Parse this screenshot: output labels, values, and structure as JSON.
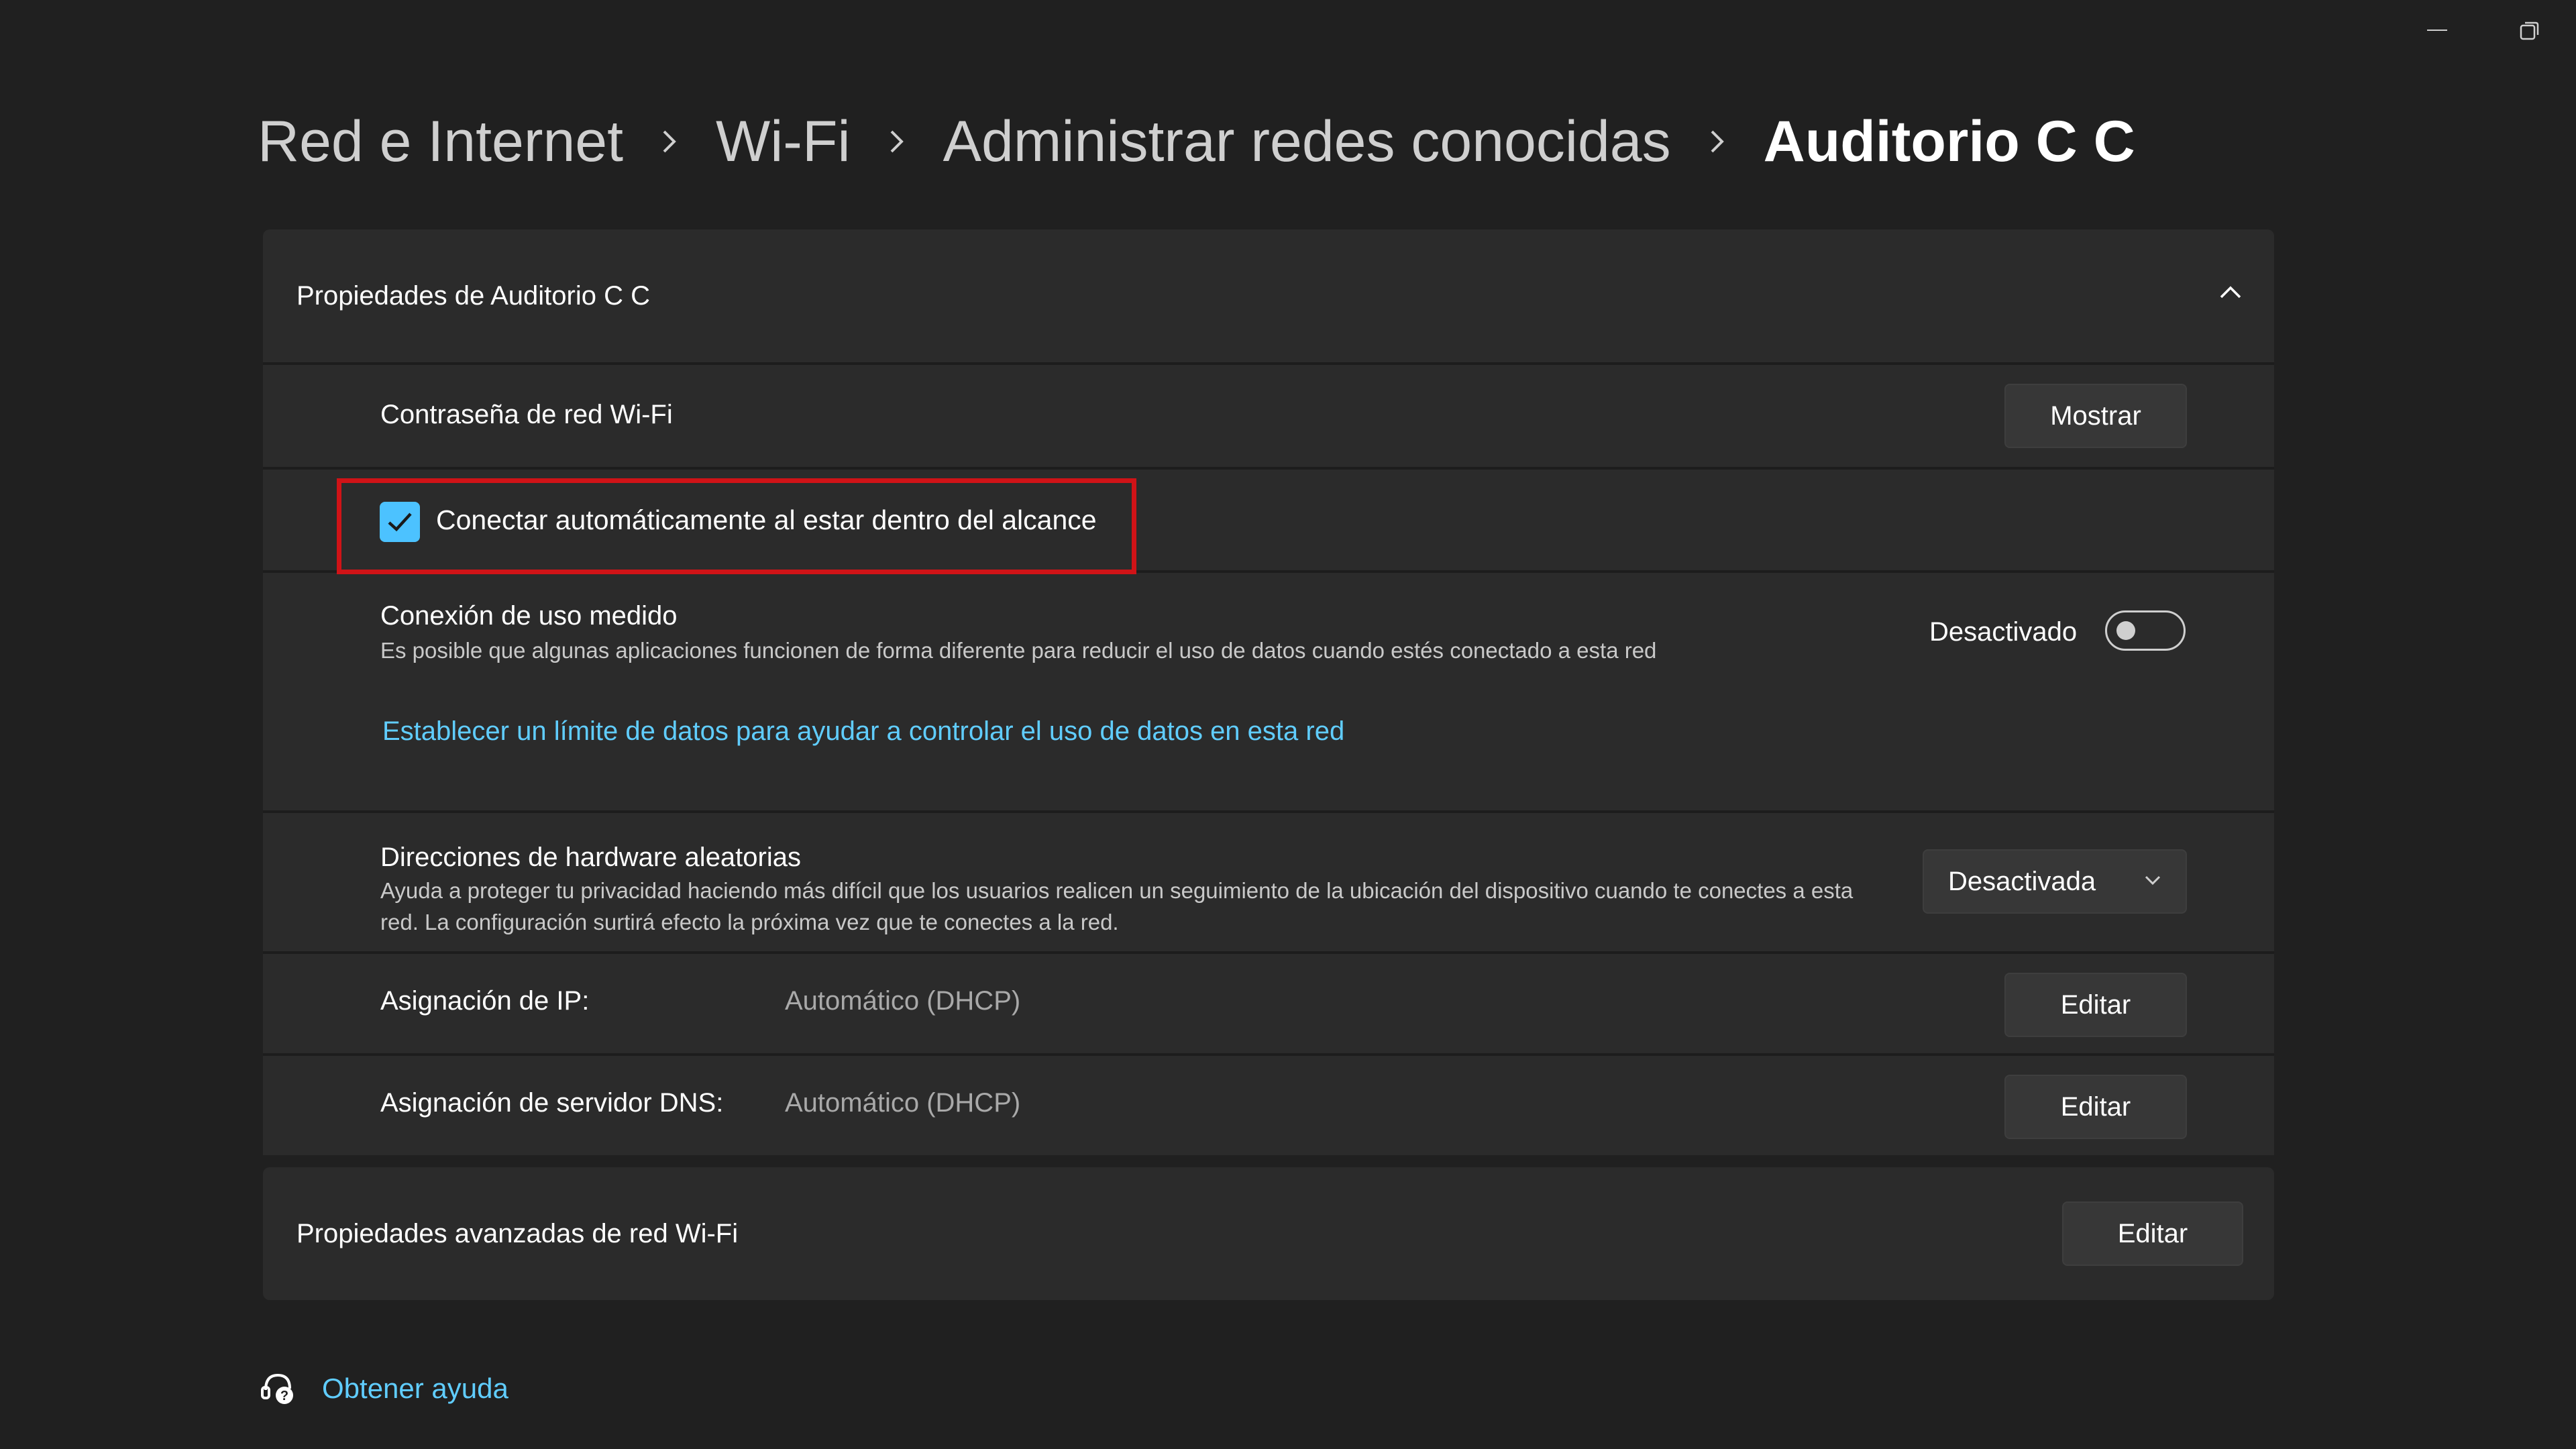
{
  "window": {
    "minimize_icon": "minimize-icon",
    "restore_icon": "restore-icon"
  },
  "breadcrumb": {
    "items": [
      "Red e Internet",
      "Wi-Fi",
      "Administrar redes conocidas"
    ],
    "current": "Auditorio C C"
  },
  "properties": {
    "title": "Propiedades de Auditorio C C",
    "collapse_icon": "chevron-up-icon",
    "password": {
      "label": "Contraseña de red Wi-Fi",
      "button": "Mostrar"
    },
    "auto_connect": {
      "label": "Conectar automáticamente al estar dentro del alcance",
      "checked": true
    },
    "metered": {
      "label": "Conexión de uso medido",
      "description": "Es posible que algunas aplicaciones funcionen de forma diferente para reducir el uso de datos cuando estés conectado a esta red",
      "state_label": "Desactivado",
      "enabled": false,
      "link": "Establecer un límite de datos para ayudar a controlar el uso de datos en esta red"
    },
    "random_hw": {
      "label": "Direcciones de hardware aleatorias",
      "description": "Ayuda a proteger tu privacidad haciendo más difícil que los usuarios realicen un seguimiento de la ubicación del dispositivo cuando te conectes a esta red. La configuración surtirá efecto la próxima vez que te conectes a la red.",
      "selected": "Desactivada"
    },
    "ip": {
      "label": "Asignación de IP:",
      "value": "Automático (DHCP)",
      "button": "Editar"
    },
    "dns": {
      "label": "Asignación de servidor DNS:",
      "value": "Automático (DHCP)",
      "button": "Editar"
    }
  },
  "advanced": {
    "title": "Propiedades avanzadas de red Wi-Fi",
    "button": "Editar"
  },
  "help": {
    "label": "Obtener ayuda",
    "icon": "help-chat-icon"
  },
  "colors": {
    "accent": "#4cc2ff",
    "link": "#60cdff",
    "highlight": "#d01317",
    "background": "#202020",
    "card": "#2b2b2b"
  }
}
